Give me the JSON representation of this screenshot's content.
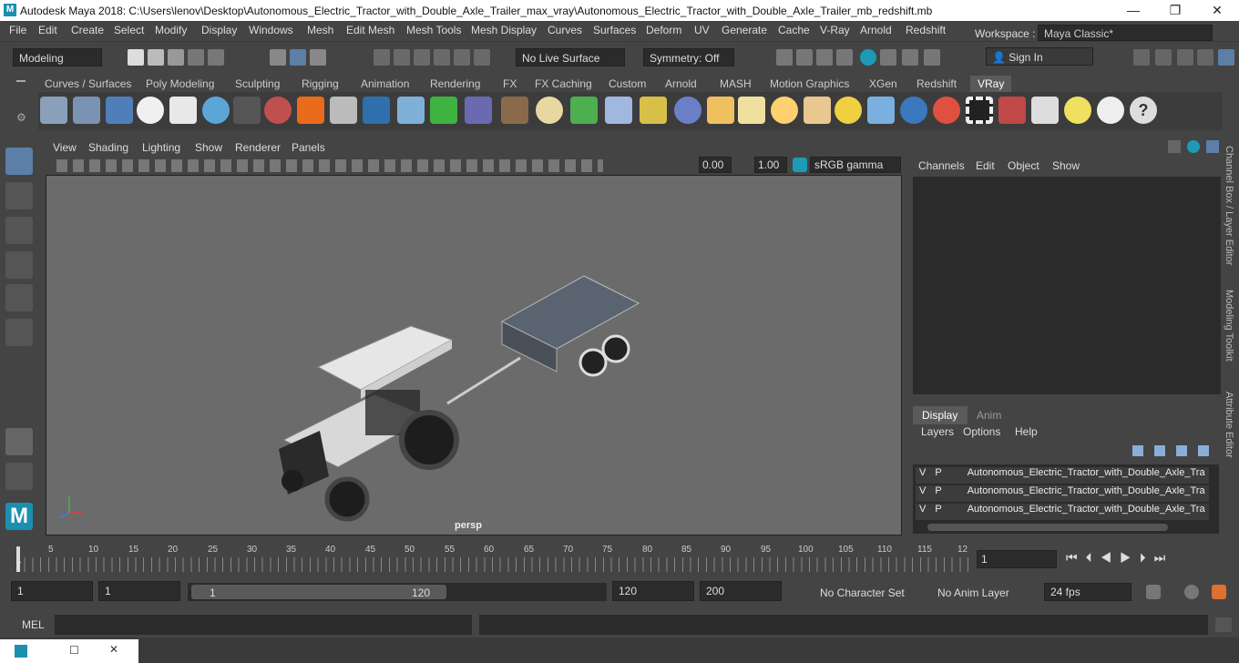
{
  "window": {
    "title": "Autodesk Maya 2018: C:\\Users\\lenov\\Desktop\\Autonomous_Electric_Tractor_with_Double_Axle_Trailer_max_vray\\Autonomous_Electric_Tractor_with_Double_Axle_Trailer_mb_redshift.mb",
    "logo": "M",
    "minimize": "—",
    "restore": "❐",
    "close": "✕"
  },
  "menubar": {
    "items": [
      "File",
      "Edit",
      "Create",
      "Select",
      "Modify",
      "Display",
      "Windows",
      "Mesh",
      "Edit Mesh",
      "Mesh Tools",
      "Mesh Display",
      "Curves",
      "Surfaces",
      "Deform",
      "UV",
      "Generate",
      "Cache",
      "V-Ray",
      "Arnold",
      "Redshift"
    ],
    "workspace_label": "Workspace :",
    "workspace_value": "Maya Classic*"
  },
  "toolbar": {
    "mode": "Modeling",
    "live_surface": "No Live Surface",
    "symmetry": "Symmetry: Off",
    "sign_in": "Sign In"
  },
  "shelf": {
    "tabs": [
      "Curves / Surfaces",
      "Poly Modeling",
      "Sculpting",
      "Rigging",
      "Animation",
      "Rendering",
      "FX",
      "FX Caching",
      "Custom",
      "Arnold",
      "MASH",
      "Motion Graphics",
      "XGen",
      "Redshift",
      "VRay"
    ],
    "active_tab": "VRay"
  },
  "viewport": {
    "menus": [
      "View",
      "Shading",
      "Lighting",
      "Show",
      "Renderer",
      "Panels"
    ],
    "exposure": "0.00",
    "gamma": "1.00",
    "color_space": "sRGB gamma",
    "camera_label": "persp"
  },
  "channel_box": {
    "menus": [
      "Channels",
      "Edit",
      "Object",
      "Show"
    ]
  },
  "layer_editor": {
    "tabs": [
      "Display",
      "Anim"
    ],
    "menus": [
      "Layers",
      "Options",
      "Help"
    ],
    "layers": [
      {
        "v": "V",
        "p": "P",
        "name": "Autonomous_Electric_Tractor_with_Double_Axle_Tra"
      },
      {
        "v": "V",
        "p": "P",
        "name": "Autonomous_Electric_Tractor_with_Double_Axle_Tra"
      },
      {
        "v": "V",
        "p": "P",
        "name": "Autonomous_Electric_Tractor_with_Double_Axle_Tra"
      }
    ]
  },
  "side_tabs": [
    "Channel Box / Layer Editor",
    "Modeling Toolkit",
    "Attribute Editor"
  ],
  "timeline": {
    "ticks": [
      "5",
      "10",
      "15",
      "20",
      "25",
      "30",
      "35",
      "40",
      "45",
      "50",
      "55",
      "60",
      "65",
      "70",
      "75",
      "80",
      "85",
      "90",
      "95",
      "100",
      "105",
      "110",
      "115",
      "12"
    ],
    "start_marker": "1",
    "current_frame": "1"
  },
  "range": {
    "start": "1",
    "playback_start": "1",
    "slider_start": "1",
    "slider_end": "120",
    "playback_end": "120",
    "end": "200",
    "character_set": "No Character Set",
    "anim_layer": "No Anim Layer",
    "fps": "24 fps"
  },
  "command_line": {
    "label": "MEL"
  }
}
